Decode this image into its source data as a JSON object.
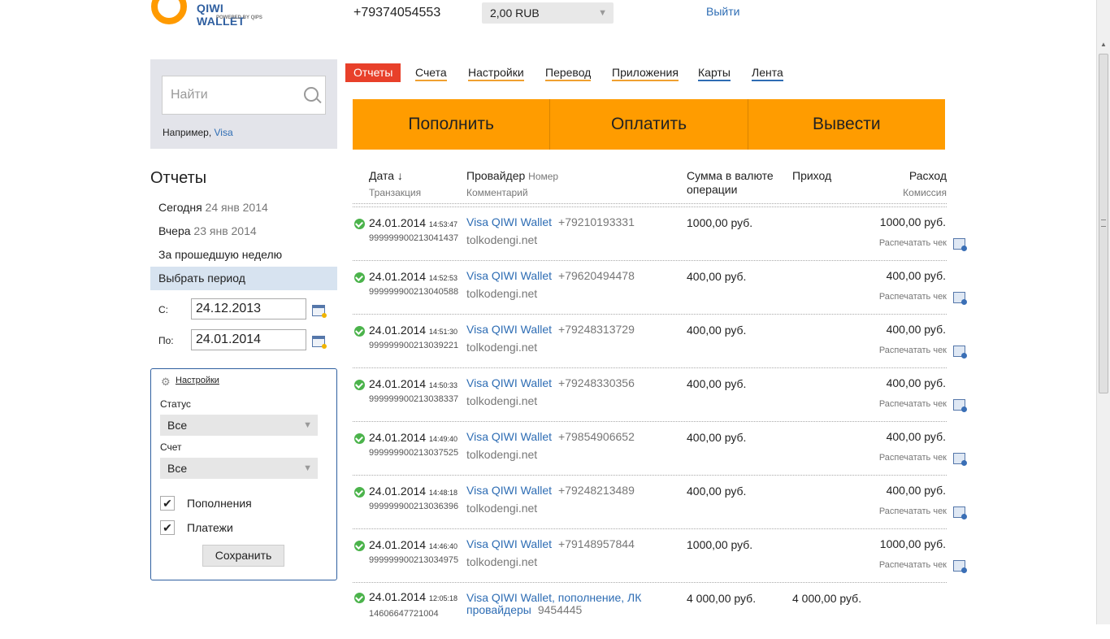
{
  "header": {
    "logo_text": "QIWI WALLET",
    "logo_sub": "POWERED BY QIPS",
    "phone": "+79374054553",
    "balance": "2,00 RUB",
    "logout": "Выйти"
  },
  "search": {
    "placeholder": "Найти",
    "example_prefix": "Например,",
    "example_link": "Visa"
  },
  "sidebar": {
    "title": "Отчеты",
    "items": [
      {
        "label": "Сегодня",
        "date": "24 янв 2014"
      },
      {
        "label": "Вчера",
        "date": "23 янв 2014"
      },
      {
        "label": "За прошедшую неделю",
        "date": ""
      },
      {
        "label": "Выбрать период",
        "date": ""
      }
    ],
    "from_label": "С:",
    "from_value": "24.12.2013",
    "to_label": "По:",
    "to_value": "24.01.2014"
  },
  "settings": {
    "link": "Настройки",
    "status_label": "Статус",
    "status_value": "Все",
    "account_label": "Счет",
    "account_value": "Все",
    "check1": "Пополнения",
    "check2": "Платежи",
    "check_mark": "✔",
    "save": "Сохранить"
  },
  "tabs": [
    "Отчеты",
    "Счета",
    "Настройки",
    "Перевод",
    "Приложения",
    "Карты",
    "Лента"
  ],
  "actions": [
    "Пополнить",
    "Оплатить",
    "Вывести"
  ],
  "table_header": {
    "date": "Дата ↓",
    "transaction": "Транзакция",
    "provider": "Провайдер",
    "number": "Номер",
    "comment": "Комментарий",
    "amount_line1": "Сумма в валюте",
    "amount_line2": "операции",
    "income": "Приход",
    "expense": "Расход",
    "commission": "Комиссия"
  },
  "rows": [
    {
      "date": "24.01.2014",
      "time": "14:53:47",
      "txn": "999999900213041437",
      "provider": "Visa QIWI Wallet",
      "number": "+79210193331",
      "comment": "tolkodengi.net",
      "amount": "1000,00 руб.",
      "income": "",
      "expense": "1000,00 руб.",
      "print": "Распечатать чек"
    },
    {
      "date": "24.01.2014",
      "time": "14:52:53",
      "txn": "999999900213040588",
      "provider": "Visa QIWI Wallet",
      "number": "+79620494478",
      "comment": "tolkodengi.net",
      "amount": "400,00 руб.",
      "income": "",
      "expense": "400,00 руб.",
      "print": "Распечатать чек"
    },
    {
      "date": "24.01.2014",
      "time": "14:51:30",
      "txn": "999999900213039221",
      "provider": "Visa QIWI Wallet",
      "number": "+79248313729",
      "comment": "tolkodengi.net",
      "amount": "400,00 руб.",
      "income": "",
      "expense": "400,00 руб.",
      "print": "Распечатать чек"
    },
    {
      "date": "24.01.2014",
      "time": "14:50:33",
      "txn": "999999900213038337",
      "provider": "Visa QIWI Wallet",
      "number": "+79248330356",
      "comment": "tolkodengi.net",
      "amount": "400,00 руб.",
      "income": "",
      "expense": "400,00 руб.",
      "print": "Распечатать чек"
    },
    {
      "date": "24.01.2014",
      "time": "14:49:40",
      "txn": "999999900213037525",
      "provider": "Visa QIWI Wallet",
      "number": "+79854906652",
      "comment": "tolkodengi.net",
      "amount": "400,00 руб.",
      "income": "",
      "expense": "400,00 руб.",
      "print": "Распечатать чек"
    },
    {
      "date": "24.01.2014",
      "time": "14:48:18",
      "txn": "999999900213036396",
      "provider": "Visa QIWI Wallet",
      "number": "+79248213489",
      "comment": "tolkodengi.net",
      "amount": "400,00 руб.",
      "income": "",
      "expense": "400,00 руб.",
      "print": "Распечатать чек"
    },
    {
      "date": "24.01.2014",
      "time": "14:46:40",
      "txn": "999999900213034975",
      "provider": "Visa QIWI Wallet",
      "number": "+79148957844",
      "comment": "tolkodengi.net",
      "amount": "1000,00 руб.",
      "income": "",
      "expense": "1000,00 руб.",
      "print": "Распечатать чек"
    }
  ],
  "last_row": {
    "date": "24.01.2014",
    "time": "12:05:18",
    "txn": "14606647721004",
    "provider_line1": "Visa QIWI Wallet, пополнение, ЛК",
    "provider_line2": "провайдеры",
    "number": "9454445",
    "amount": "4 000,00 руб.",
    "income": "4 000,00 руб."
  },
  "colors": {
    "accent_orange": "#ff9c00",
    "tab_active": "#e8402a",
    "link_blue": "#2e6db4",
    "status_ok": "#4bb34b"
  },
  "icons": [
    "qiwi-logo",
    "search-icon",
    "calendar-icon",
    "gear-icon",
    "checkbox-checked-icon",
    "status-ok-icon",
    "print-icon"
  ]
}
